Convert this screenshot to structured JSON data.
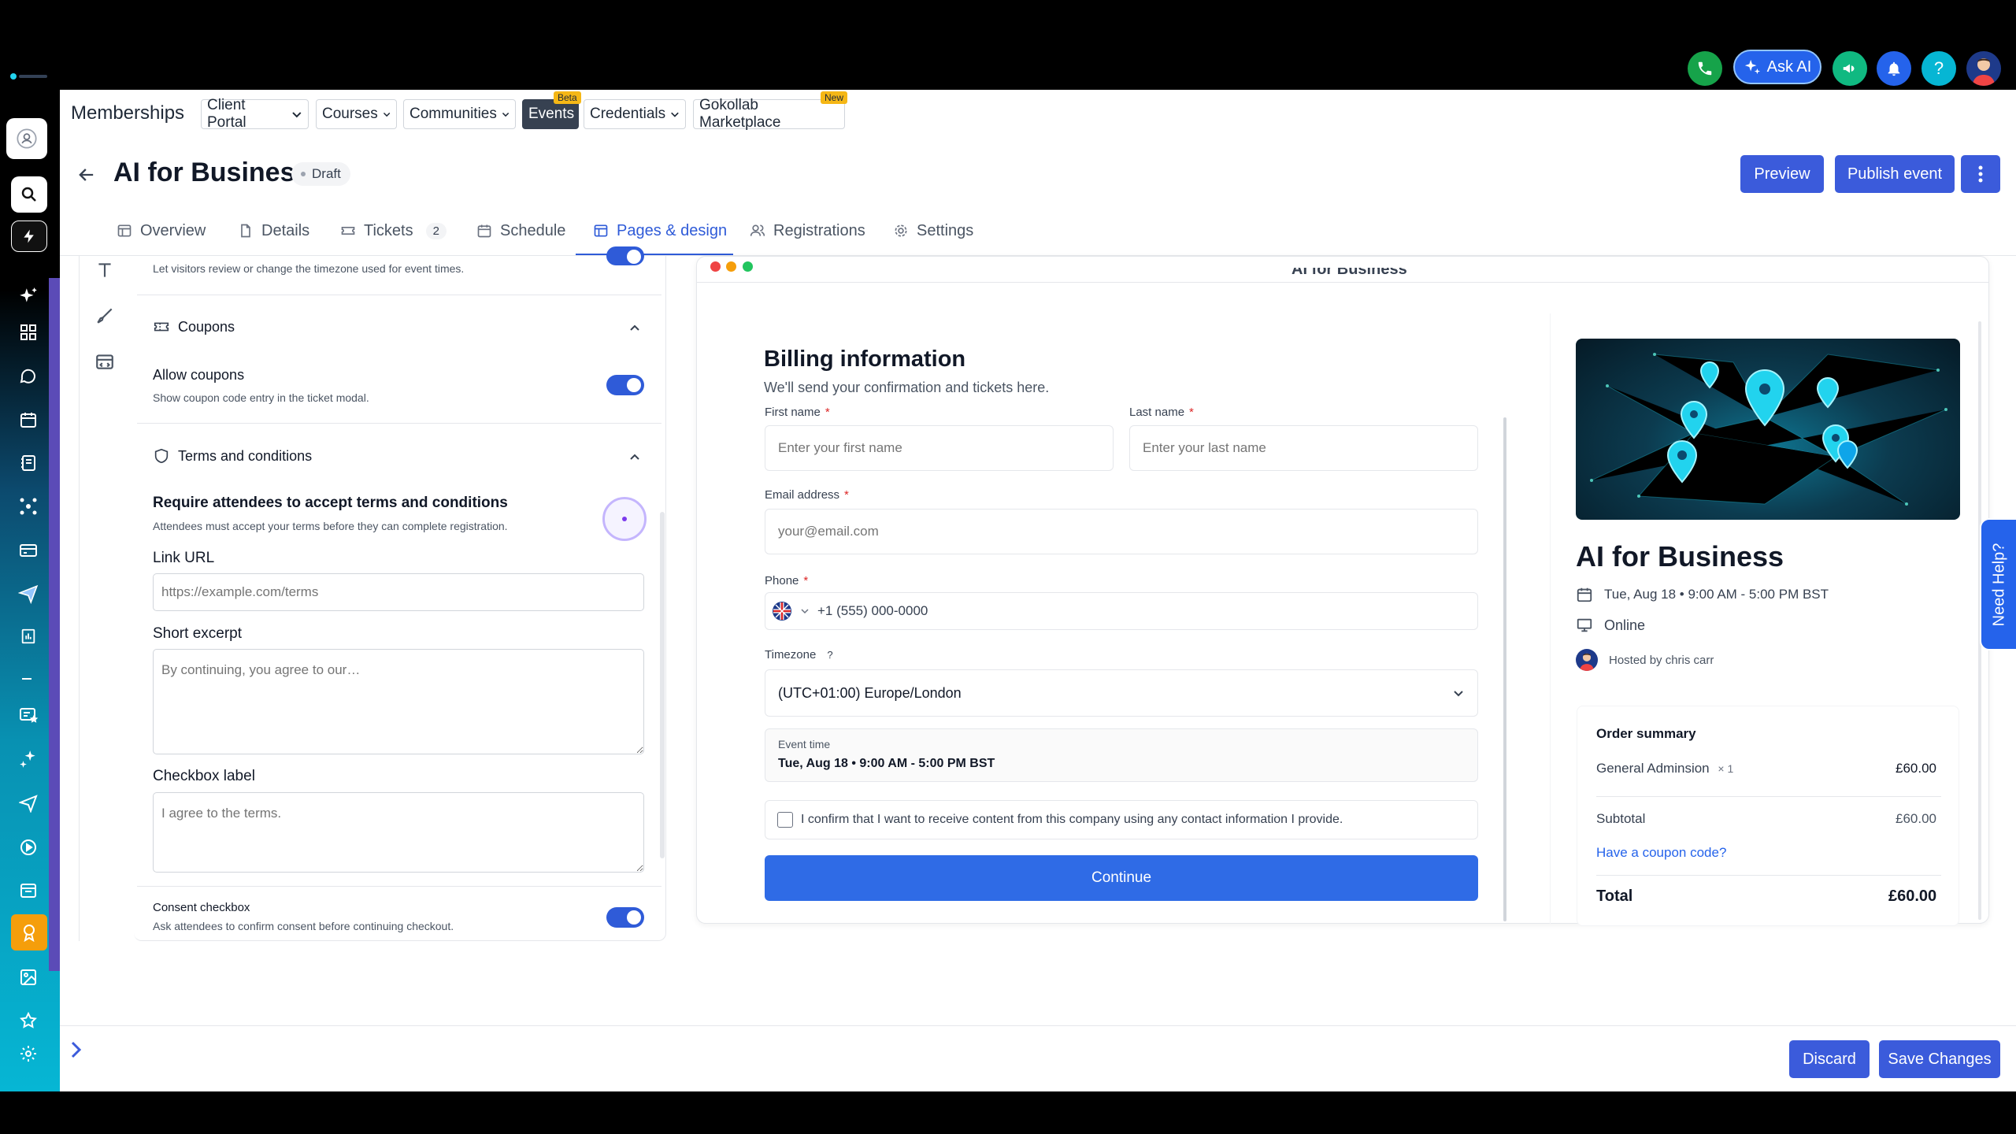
{
  "topbar": {
    "ask_ai_label": "Ask AI",
    "icons": [
      "phone-icon",
      "sparkle-icon",
      "megaphone-icon",
      "bell-icon",
      "help-icon",
      "avatar"
    ]
  },
  "nav": {
    "title": "Memberships",
    "tabs": [
      {
        "label": "Client Portal",
        "dropdown": true
      },
      {
        "label": "Courses",
        "dropdown": true
      },
      {
        "label": "Communities",
        "dropdown": true
      },
      {
        "label": "Events",
        "dropdown": false,
        "badge": "Beta",
        "active": true
      },
      {
        "label": "Credentials",
        "dropdown": true
      },
      {
        "label": "Gokollab Marketplace",
        "dropdown": false,
        "badge": "New"
      }
    ]
  },
  "header": {
    "title": "AI for Business",
    "status": "Draft",
    "preview_label": "Preview",
    "publish_label": "Publish event"
  },
  "event_tabs": [
    {
      "label": "Overview",
      "icon": "layout-icon"
    },
    {
      "label": "Details",
      "icon": "file-icon"
    },
    {
      "label": "Tickets",
      "icon": "ticket-icon",
      "count": "2"
    },
    {
      "label": "Schedule",
      "icon": "calendar-icon"
    },
    {
      "label": "Pages & design",
      "icon": "layout-icon",
      "active": true
    },
    {
      "label": "Registrations",
      "icon": "users-icon"
    },
    {
      "label": "Settings",
      "icon": "gear-icon"
    }
  ],
  "settings": {
    "timezone_desc": "Let visitors review or change the timezone used for event times.",
    "coupons_title": "Coupons",
    "allow_coupons_label": "Allow coupons",
    "allow_coupons_desc": "Show coupon code entry in the ticket modal.",
    "terms_title": "Terms and conditions",
    "require_terms_label": "Require attendees to accept terms and conditions",
    "require_terms_desc": "Attendees must accept your terms before they can complete registration.",
    "link_url_label": "Link URL",
    "link_url_placeholder": "https://example.com/terms",
    "short_excerpt_label": "Short excerpt",
    "short_excerpt_placeholder": "By continuing, you agree to our…",
    "checkbox_label_label": "Checkbox label",
    "checkbox_label_placeholder": "I agree to the terms.",
    "consent_label": "Consent checkbox",
    "consent_desc": "Ask attendees to confirm consent before continuing checkout."
  },
  "preview": {
    "window_title": "AI for Business",
    "billing_title": "Billing information",
    "billing_subtitle": "We'll send your confirmation and tickets here.",
    "first_name_label": "First name",
    "first_name_placeholder": "Enter your first name",
    "last_name_label": "Last name",
    "last_name_placeholder": "Enter your last name",
    "email_label": "Email address",
    "email_placeholder": "your@email.com",
    "phone_label": "Phone",
    "phone_placeholder": "+1 (555) 000-0000",
    "timezone_label": "Timezone",
    "timezone_help": "?",
    "timezone_value": "(UTC+01:00) Europe/London",
    "event_time_label": "Event time",
    "event_time_value": "Tue, Aug 18 • 9:00 AM - 5:00 PM BST",
    "consent_text": "I confirm that I want to receive content from this company using any contact information I provide.",
    "continue_label": "Continue"
  },
  "event_card": {
    "name": "AI for Business",
    "date": "Tue, Aug 18 • 9:00 AM - 5:00 PM BST",
    "location": "Online",
    "host": "Hosted by chris carr"
  },
  "order_summary": {
    "title": "Order summary",
    "item_name": "General Adminsion",
    "item_qty": "× 1",
    "item_price": "£60.00",
    "subtotal_label": "Subtotal",
    "subtotal_value": "£60.00",
    "coupon_link": "Have a coupon code?",
    "total_label": "Total",
    "total_value": "£60.00"
  },
  "need_help_label": "Need Help?",
  "footer": {
    "discard_label": "Discard",
    "save_label": "Save Changes"
  },
  "colors": {
    "primary": "#3b5bdb",
    "continue": "#2f6be6",
    "active_tab": "#2f5bd8",
    "phone_green": "#16a34a",
    "megaphone_green": "#10b981",
    "bell_blue": "#2563eb",
    "help_cyan": "#06b6d4"
  }
}
